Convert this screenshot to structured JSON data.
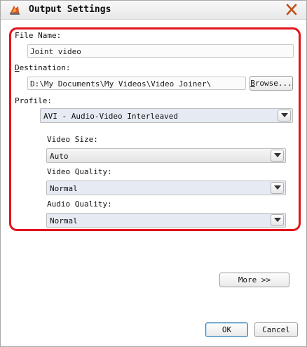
{
  "dialog": {
    "title": "Output Settings",
    "app_icon": "app-logo-icon",
    "close_icon": "close-icon"
  },
  "file_name": {
    "label": "File Name:",
    "value": "Joint video"
  },
  "destination": {
    "label_rest": "estination:",
    "label_accel": "D",
    "value": "D:\\My Documents\\My Videos\\Video Joiner\\",
    "browse_accel": "B",
    "browse_rest": "rowse..."
  },
  "profile": {
    "label": "Profile:",
    "selected": "AVI - Audio-Video Interleaved"
  },
  "video_size": {
    "label": "Video Size:",
    "selected": "Auto"
  },
  "video_quality": {
    "label": "Video Quality:",
    "selected": "Normal"
  },
  "audio_quality": {
    "label": "Audio Quality:",
    "selected": "Normal"
  },
  "buttons": {
    "more": "More >>",
    "ok": "OK",
    "cancel": "Cancel"
  },
  "colors": {
    "highlight": "#e3131b",
    "default_button_border": "#3c7fb1"
  }
}
